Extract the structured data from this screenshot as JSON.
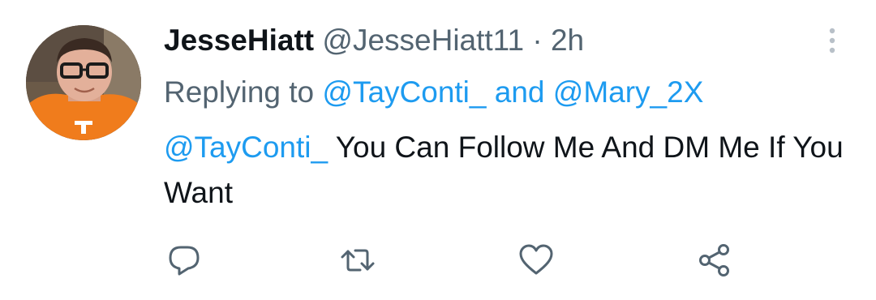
{
  "tweet": {
    "display_name": "JesseHiatt",
    "handle": "@JesseHiatt11",
    "separator": "·",
    "time": "2h",
    "reply": {
      "prefix": "Replying to",
      "user1": "@TayConti_",
      "conjunction": "and",
      "user2": "@Mary_2X"
    },
    "body": {
      "mention": "@TayConti_",
      "text": "You Can Follow Me And DM Me If You Want"
    },
    "icons": {
      "more": "more-vertical-icon",
      "reply": "reply-bubble-icon",
      "retweet": "retweet-icon",
      "like": "heart-icon",
      "share": "share-icon"
    }
  },
  "colors": {
    "link": "#1d9bf0",
    "muted": "#536471",
    "text": "#0f1419",
    "icon": "#536471"
  }
}
